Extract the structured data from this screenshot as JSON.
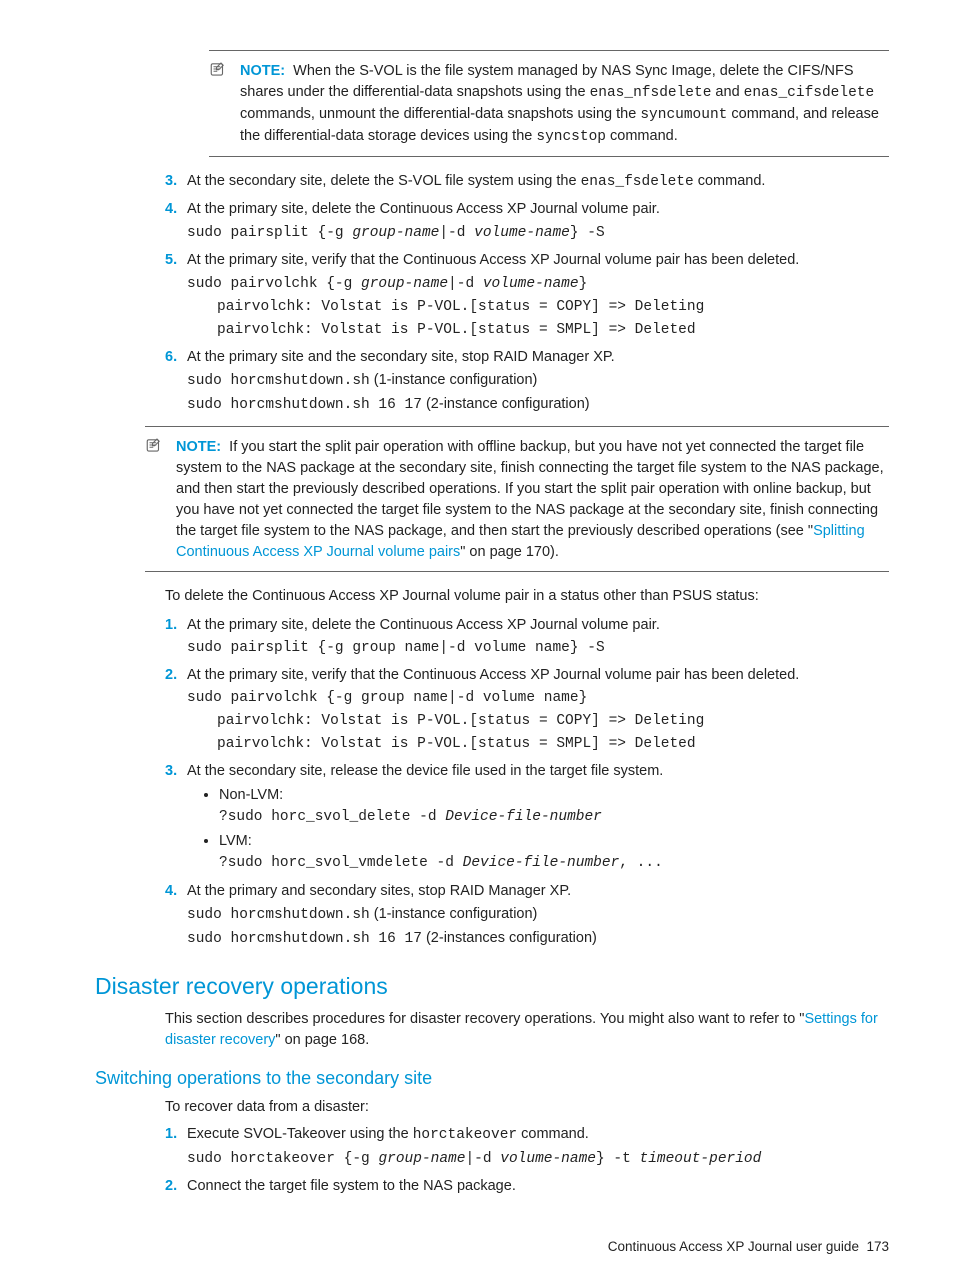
{
  "note1": {
    "label": "NOTE:",
    "text_pre": "When the S-VOL is the file system managed by NAS Sync Image, delete the CIFS/NFS shares under the differential-data snapshots using the ",
    "cmd1": "enas_nfsdelete",
    "text_and": " and ",
    "cmd2": "enas_cifsdelete",
    "text_mid": " commands, unmount the differential-data snapshots using the ",
    "cmd3": "syncumount",
    "text_mid2": " command, and release the differential-data storage devices using the ",
    "cmd4": "syncstop",
    "text_end": " command."
  },
  "listA": {
    "i3": {
      "num": "3.",
      "text_pre": "At the secondary site, delete the S-VOL file system using the ",
      "cmd": "enas_fsdelete",
      "text_end": " command."
    },
    "i4": {
      "num": "4.",
      "text": "At the primary site, delete the Continuous Access XP Journal volume pair.",
      "cmd_pre": "sudo pairsplit {-g ",
      "cmd_v1": "group-name",
      "cmd_mid": "|-d ",
      "cmd_v2": "volume-name",
      "cmd_end": "} -S"
    },
    "i5": {
      "num": "5.",
      "text": "At the primary site, verify that the Continuous Access XP Journal volume pair has been deleted.",
      "cmd1_pre": "sudo pairvolchk {-g ",
      "cmd1_v1": "group-name",
      "cmd1_mid": "|-d ",
      "cmd1_v2": "volume-name",
      "cmd1_end": "}",
      "out1": "pairvolchk: Volstat is P-VOL.[status = COPY] => Deleting",
      "out2": "pairvolchk: Volstat is P-VOL.[status = SMPL] => Deleted"
    },
    "i6": {
      "num": "6.",
      "text": "At the primary site and the secondary site, stop RAID Manager XP.",
      "cmd1": "sudo horcmshutdown.sh",
      "suf1": " (1-instance configuration)",
      "cmd2": "sudo horcmshutdown.sh 16 17",
      "suf2": " (2-instance configuration)"
    }
  },
  "note2": {
    "label": "NOTE:",
    "text_pre": "If you start the split pair operation with offline backup, but you have not yet connected the target file system to the NAS package at the secondary site, finish connecting the target file system to the NAS package, and then start the previously described operations. If you start the split pair operation with online backup, but you have not yet connected the target file system to the NAS package at the secondary site, finish connecting the target file system to the NAS package, and then start the previously described operations (see \"",
    "link": "Splitting Continuous Access XP Journal volume pairs",
    "text_end": "\" on page 170)."
  },
  "intro2": "To delete the Continuous Access XP Journal volume pair in a status other than PSUS status:",
  "listB": {
    "i1": {
      "num": "1.",
      "text": "At the primary site, delete the Continuous Access XP Journal volume pair.",
      "cmd": "sudo pairsplit {-g group name|-d volume name} -S"
    },
    "i2": {
      "num": "2.",
      "text": "At the primary site, verify that the Continuous Access XP Journal volume pair has been deleted.",
      "cmd1": "sudo pairvolchk {-g group name|-d volume name}",
      "out1": "pairvolchk: Volstat is P-VOL.[status = COPY] => Deleting",
      "out2": "pairvolchk: Volstat is P-VOL.[status = SMPL] => Deleted"
    },
    "i3": {
      "num": "3.",
      "text": "At the secondary site, release the device file used in the target file system.",
      "b1_label": "Non-LVM:",
      "b1_cmd_pre": "?sudo horc_svol_delete -d ",
      "b1_cmd_v": "Device-file-number",
      "b2_label": "LVM:",
      "b2_cmd_pre": "?sudo horc_svol_vmdelete -d ",
      "b2_cmd_v": "Device-file-number",
      "b2_cmd_end": ", ..."
    },
    "i4": {
      "num": "4.",
      "text": "At the primary and secondary sites, stop RAID Manager XP.",
      "cmd1": "sudo horcmshutdown.sh",
      "suf1": " (1-instance configuration)",
      "cmd2": "sudo horcmshutdown.sh 16 17",
      "suf2": " (2-instances configuration)"
    }
  },
  "h2": "Disaster recovery operations",
  "dr_intro_pre": "This section describes procedures for disaster recovery operations. You might also want to refer to \"",
  "dr_intro_link": "Settings for disaster recovery",
  "dr_intro_end": "\" on page 168.",
  "h3": "Switching operations to the secondary site",
  "sw_intro": "To recover data from a disaster:",
  "listC": {
    "i1": {
      "num": "1.",
      "text_pre": "Execute SVOL-Takeover using the ",
      "cmd": "horctakeover",
      "text_end": " command.",
      "c_pre": "sudo horctakeover {-g ",
      "c_v1": "group-name",
      "c_mid": "|-d ",
      "c_v2": "volume-name",
      "c_mid2": "} -t ",
      "c_v3": "timeout-period"
    },
    "i2": {
      "num": "2.",
      "text": "Connect the target file system to the NAS package."
    }
  },
  "footer": {
    "title": "Continuous Access XP Journal user guide",
    "page": "173"
  }
}
